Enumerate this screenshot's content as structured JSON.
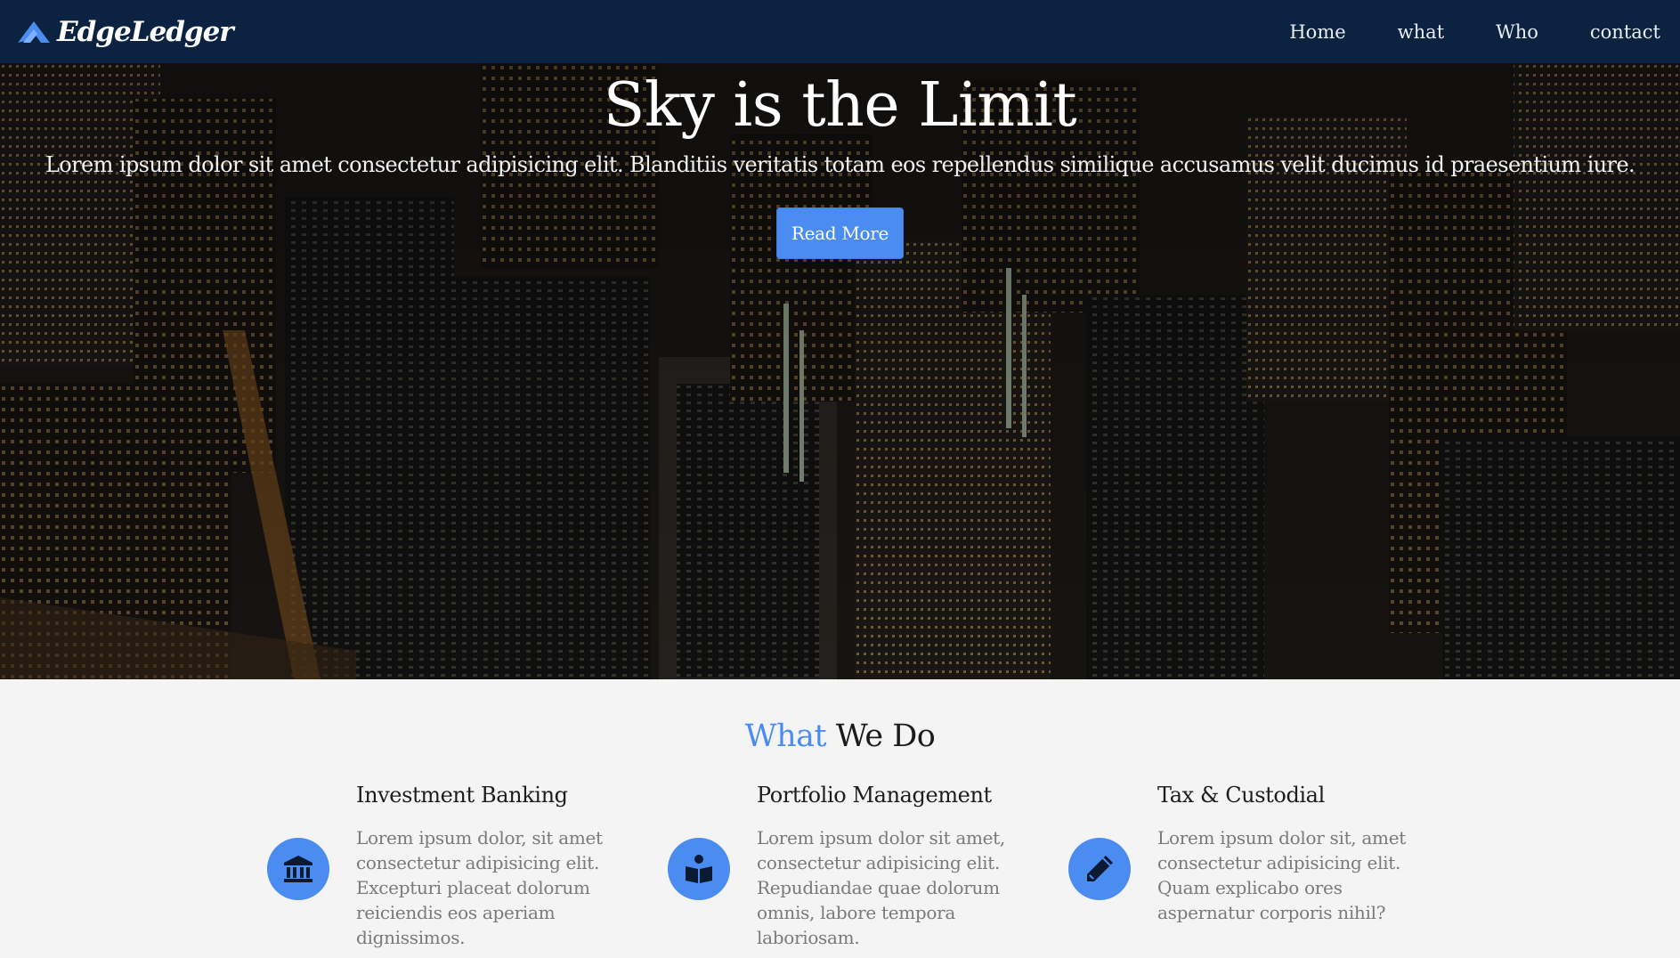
{
  "brand": {
    "name": "EdgeLedger"
  },
  "nav": {
    "items": [
      {
        "label": "Home"
      },
      {
        "label": "what"
      },
      {
        "label": "Who"
      },
      {
        "label": "contact"
      }
    ]
  },
  "hero": {
    "title": "Sky is the Limit",
    "subtitle": "Lorem ipsum dolor sit amet consectetur adipisicing elit. Blanditiis veritatis totam eos repellendus similique accusamus velit ducimus id praesentium iure.",
    "button_label": "Read More"
  },
  "section": {
    "title_accent": "What",
    "title_rest": "We Do",
    "features": [
      {
        "title": "Investment Banking",
        "text": "Lorem ipsum dolor, sit amet consectetur adipisicing elit. Excepturi placeat dolorum reiciendis eos aperiam dignissimos.",
        "icon": "bank-icon"
      },
      {
        "title": "Portfolio Management",
        "text": "Lorem ipsum dolor sit amet, consectetur adipisicing elit. Repudiandae quae dolorum omnis, labore tempora laboriosam.",
        "icon": "reader-icon"
      },
      {
        "title": "Tax & Custodial",
        "text": "Lorem ipsum dolor sit, amet consectetur adipisicing elit. Quam explicabo ores aspernatur corporis nihil?",
        "icon": "pencil-icon"
      }
    ]
  },
  "colors": {
    "navbar": "#0b2340",
    "accent": "#4a8cf0",
    "section_bg": "#f4f4f4"
  }
}
